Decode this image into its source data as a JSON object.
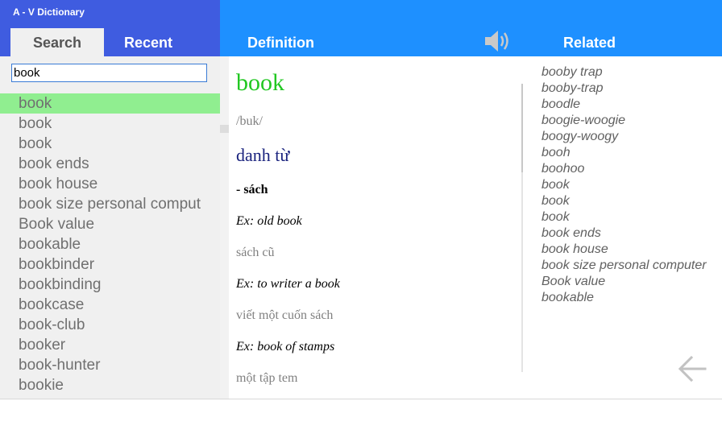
{
  "app": {
    "title": "A - V Dictionary"
  },
  "tabs": {
    "search": "Search",
    "recent": "Recent"
  },
  "header": {
    "definition": "Definition",
    "related": "Related"
  },
  "icons": {
    "speaker": "speaker-icon",
    "back": "back-arrow-icon"
  },
  "colors": {
    "left_header": "#3f5ce0",
    "right_header": "#1e90ff",
    "selected_row": "#90ee90",
    "headword": "#22c722",
    "part_of_speech": "#1a237e"
  },
  "search": {
    "value": "book"
  },
  "suggestions": [
    "book",
    "book",
    "book",
    "book ends",
    "book house",
    "book size personal comput",
    "Book value",
    "bookable",
    "bookbinder",
    "bookbinding",
    "bookcase",
    "book-club",
    "booker",
    "book-hunter",
    "bookie"
  ],
  "selected_suggestion": 0,
  "definition": {
    "word": "book",
    "pronunciation": "/buk/",
    "part_of_speech": "danh từ",
    "meaning": "- sách",
    "examples": [
      {
        "ex": "Ex: old book",
        "tr": "sách cũ"
      },
      {
        "ex": "Ex: to writer a book",
        "tr": "viết một cuốn sách"
      },
      {
        "ex": "Ex: book of stamps",
        "tr": "một tập tem"
      }
    ]
  },
  "related": [
    "booby trap",
    "booby-trap",
    "boodle",
    "boogie-woogie",
    "boogy-woogy",
    "booh",
    "boohoo",
    "book",
    "book",
    "book",
    "book ends",
    "book house",
    "book size personal computer",
    "Book value",
    "bookable"
  ]
}
